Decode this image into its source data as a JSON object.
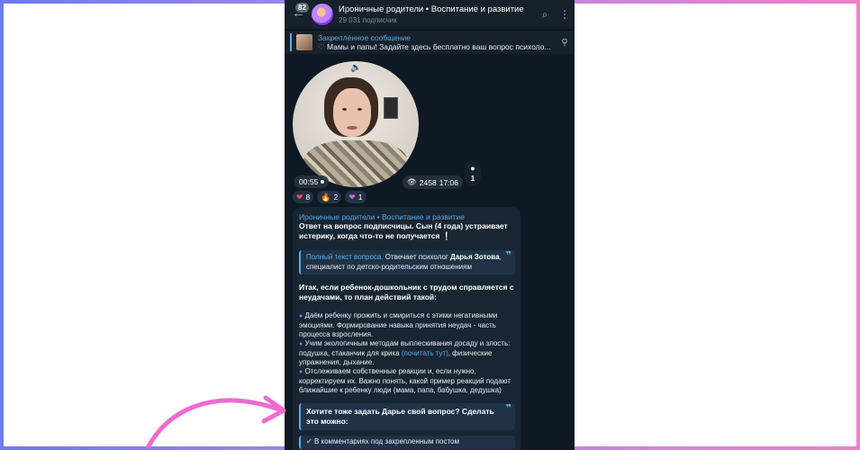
{
  "header": {
    "unread_count": "82",
    "channel_title": "Ироничные родители • Воспитание и развитие",
    "subscribers": "29 031 подписчик"
  },
  "pinned": {
    "label": "Закреплённое сообщение",
    "message": "Мамы и папы! Задайте здесь бесплатно ваш вопрос психоло..."
  },
  "video": {
    "duration": "00:55",
    "views": "2458",
    "time": "17:06",
    "comments": "1"
  },
  "reactions": [
    {
      "icon": "heart",
      "count": "8"
    },
    {
      "icon": "fire",
      "count": "2"
    },
    {
      "icon": "heart-pink",
      "count": "1"
    }
  ],
  "message": {
    "sender": "Ироничные родители • Воспитание и развитие",
    "intro": "Ответ на вопрос подписчицы. Сын (4 года) устраивает истерику, когда что-то не получается",
    "quote1": {
      "link": "Полный текст вопроса.",
      "text_before_name": " Отвечает психолог ",
      "name": "Дарья Зотова",
      "text_after": ", специалист по детско-родительским отношениям"
    },
    "plan": "Итак, если ребенок-дошкольник с трудом справляется с неудачами, то план действий такой:",
    "point1": "Даём ребенку прожить и смириться с этими негативными эмоциями. Формирование навыка принятия неудач - часть процесса взросления.",
    "point2_before": "Учим экологичным методам выплескивания досаду и злость: подушка, стаканчик для крика ",
    "point2_link": "(почитать тут)",
    "point2_after": ", физические упражнения, дыхание.",
    "point3": "Отслеживаем собственные реакции и, если нужно, корректируем их. Важно понять, какой пример реакций подают ближайшие к ребенку люди (мама, папа, бабушка, дедушка)",
    "quote2": "Хотите тоже задать Дарье свой вопрос? Сделать это можно:",
    "footer_option": "В комментариях под закрепленным постом"
  }
}
